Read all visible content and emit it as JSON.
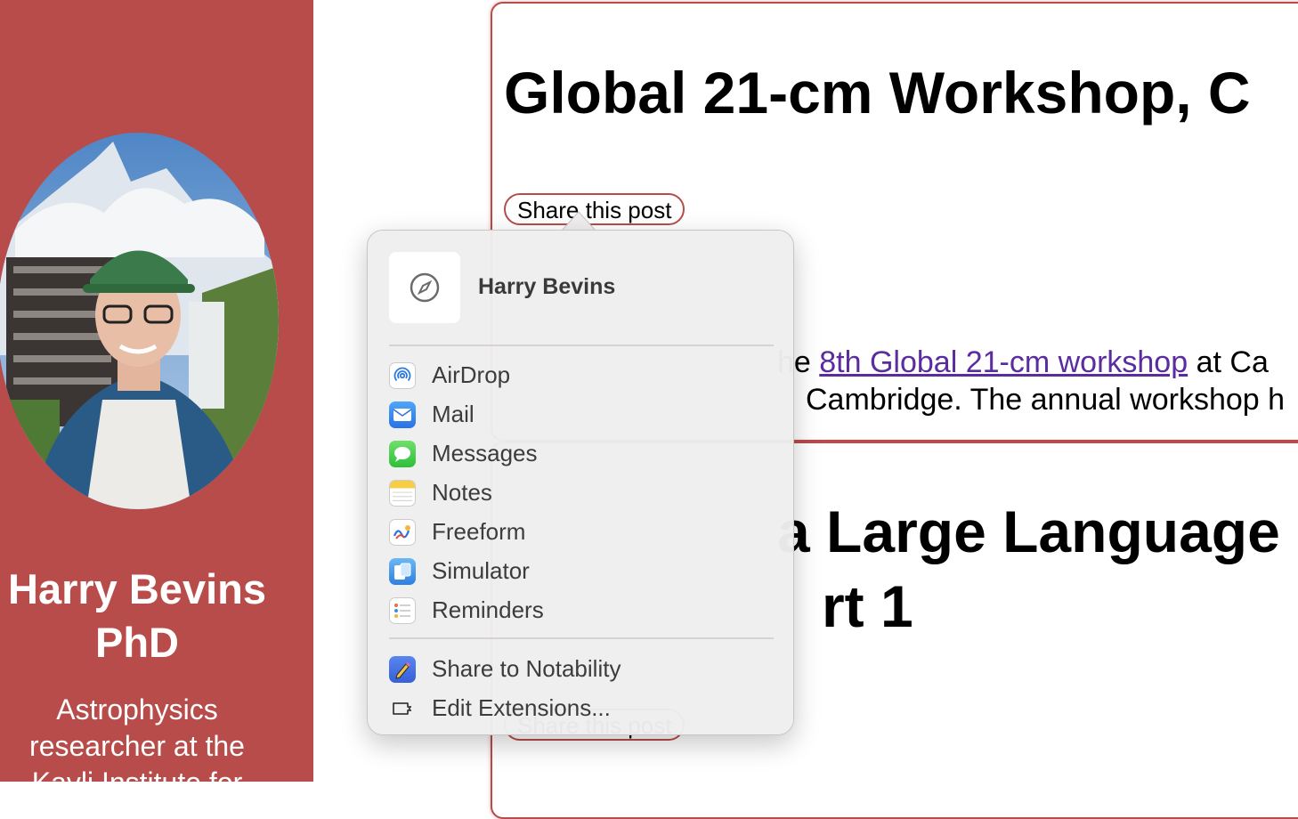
{
  "sidebar": {
    "name_line1": "Harry Bevins",
    "name_line2": "PhD",
    "bio": "Astrophysics researcher at the Kavli Institute for"
  },
  "posts": [
    {
      "title": "Global 21-cm Workshop, C",
      "share_label": "Share this post",
      "text_prefix": "he ",
      "link_text": "8th Global 21-cm workshop",
      "text_suffix": " at Ca",
      "text_line2": "Cambridge. The annual workshop h"
    },
    {
      "title_line1": "a Large Language",
      "title_line2": "rt 1",
      "share_label": "Share this post"
    }
  ],
  "share_menu": {
    "title": "Harry Bevins",
    "header_icon": "compass-icon",
    "apps": [
      {
        "label": "AirDrop",
        "icon": "airdrop-icon"
      },
      {
        "label": "Mail",
        "icon": "mail-icon"
      },
      {
        "label": "Messages",
        "icon": "messages-icon"
      },
      {
        "label": "Notes",
        "icon": "notes-icon"
      },
      {
        "label": "Freeform",
        "icon": "freeform-icon"
      },
      {
        "label": "Simulator",
        "icon": "simulator-icon"
      },
      {
        "label": "Reminders",
        "icon": "reminders-icon"
      }
    ],
    "extensions": [
      {
        "label": "Share to Notability",
        "icon": "notability-icon"
      },
      {
        "label": "Edit Extensions...",
        "icon": "edit-extensions-icon"
      }
    ]
  },
  "colors": {
    "sidebar_bg": "#b74c4a",
    "accent": "#b74c4a",
    "link": "#5a2ca0"
  }
}
